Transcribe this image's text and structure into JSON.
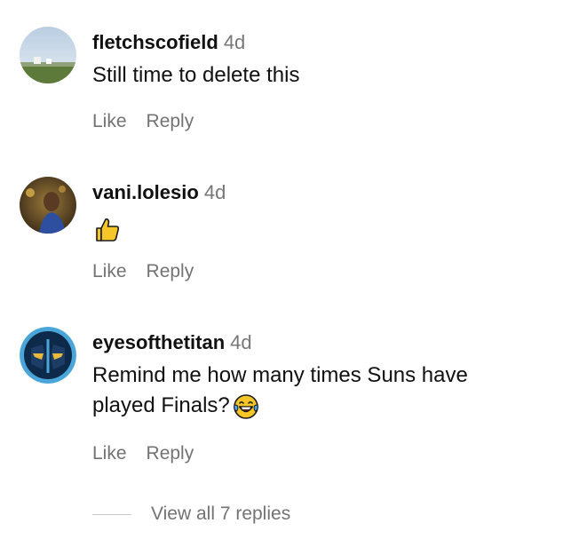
{
  "comments": [
    {
      "username": "fletchscofield",
      "time": "4d",
      "text": "Still time to delete this",
      "emoji": "",
      "avatar_icon": "landscape-avatar-icon",
      "like_label": "Like",
      "reply_label": "Reply"
    },
    {
      "username": "vani.lolesio",
      "time": "4d",
      "text": "",
      "emoji": "thumbs-up-emoji",
      "avatar_icon": "person-avatar-icon",
      "like_label": "Like",
      "reply_label": "Reply"
    },
    {
      "username": "eyesofthetitan",
      "time": "4d",
      "text": "Remind me how many times Suns have played Finals?",
      "emoji": "laughing-tears-emoji",
      "avatar_icon": "titan-helmet-avatar-icon",
      "like_label": "Like",
      "reply_label": "Reply"
    }
  ],
  "view_replies": {
    "label": "View all 7 replies"
  },
  "colors": {
    "username": "#111111",
    "meta": "#777777",
    "action": "#737373",
    "divider": "#c7c7c7",
    "emoji_yellow": "#f6c628"
  }
}
